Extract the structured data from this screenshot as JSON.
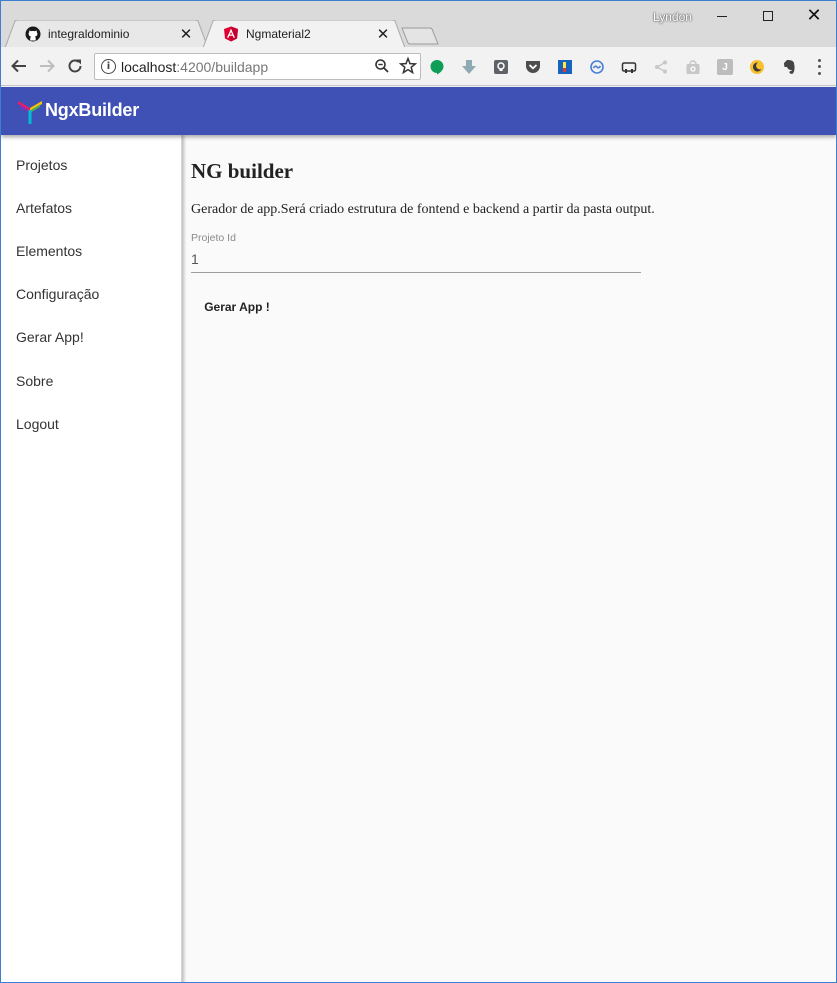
{
  "window": {
    "profile_name": "Lyndon"
  },
  "tabs": [
    {
      "title": "integraldominio",
      "favicon": "github-icon",
      "active": false
    },
    {
      "title": "Ngmaterial2",
      "favicon": "angular-icon",
      "active": true
    }
  ],
  "toolbar": {
    "url_host": "localhost",
    "url_path": ":4200/buildapp",
    "extensions": [
      "hangouts-icon",
      "download-icon",
      "keep-icon",
      "pocket-icon",
      "extension-blue-icon",
      "sync-icon",
      "shortcut-icon",
      "share-icon",
      "bag-icon",
      "j-extension-icon",
      "moon-icon",
      "evernote-icon"
    ]
  },
  "app": {
    "brand": "NgxBuilder",
    "header_color": "#3f51b5",
    "nav_items": [
      {
        "label": "Projetos"
      },
      {
        "label": "Artefatos"
      },
      {
        "label": "Elementos"
      },
      {
        "label": "Configuração"
      },
      {
        "label": "Gerar App!"
      },
      {
        "label": "Sobre"
      },
      {
        "label": "Logout"
      }
    ]
  },
  "main": {
    "title": "NG builder",
    "description": "Gerador de app.Será criado estrutura de fontend e backend a partir da pasta output.",
    "field_label": "Projeto Id",
    "field_value": "1",
    "button_label": "Gerar App !"
  }
}
